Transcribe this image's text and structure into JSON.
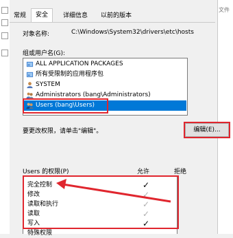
{
  "background_window": {
    "right_label": "文件"
  },
  "tabs": [
    {
      "label": "常规",
      "active": false
    },
    {
      "label": "安全",
      "active": true
    },
    {
      "label": "详细信息",
      "active": false
    },
    {
      "label": "以前的版本",
      "active": false
    }
  ],
  "object_name": {
    "label": "对象名称:",
    "value": "C:\\Windows\\System32\\drivers\\etc\\hosts"
  },
  "groups": {
    "label": "组或用户名(G):",
    "items": [
      {
        "icon": "group-icon",
        "label": "ALL APPLICATION PACKAGES",
        "selected": false
      },
      {
        "icon": "group-icon",
        "label": "所有受限制的应用程序包",
        "selected": false
      },
      {
        "icon": "user-icon",
        "label": "SYSTEM",
        "selected": false
      },
      {
        "icon": "group-icon",
        "label": "Administrators (bang\\Administrators)",
        "selected": false
      },
      {
        "icon": "group-icon",
        "label": "Users (bang\\Users)",
        "selected": true
      }
    ]
  },
  "change_hint": "要更改权限，请单击\"编辑\"。",
  "edit_button": {
    "label": "编辑(E)..."
  },
  "permissions": {
    "header": "Users 的权限(P)",
    "allow_label": "允许",
    "deny_label": "拒绝",
    "rows": [
      {
        "name": "完全控制",
        "allow": "✓",
        "allow_state": "enabled"
      },
      {
        "name": "修改",
        "allow": "✓",
        "allow_state": "disabled"
      },
      {
        "name": "读取和执行",
        "allow": "✓",
        "allow_state": "disabled"
      },
      {
        "name": "读取",
        "allow": "✓",
        "allow_state": "disabled"
      },
      {
        "name": "写入",
        "allow": "✓",
        "allow_state": "enabled"
      },
      {
        "name": "特殊权限",
        "allow": "",
        "allow_state": "none"
      }
    ]
  },
  "colors": {
    "accent": "#0078d7",
    "annotation": "#e0262e",
    "disabled_check": "#b0b0b0"
  }
}
